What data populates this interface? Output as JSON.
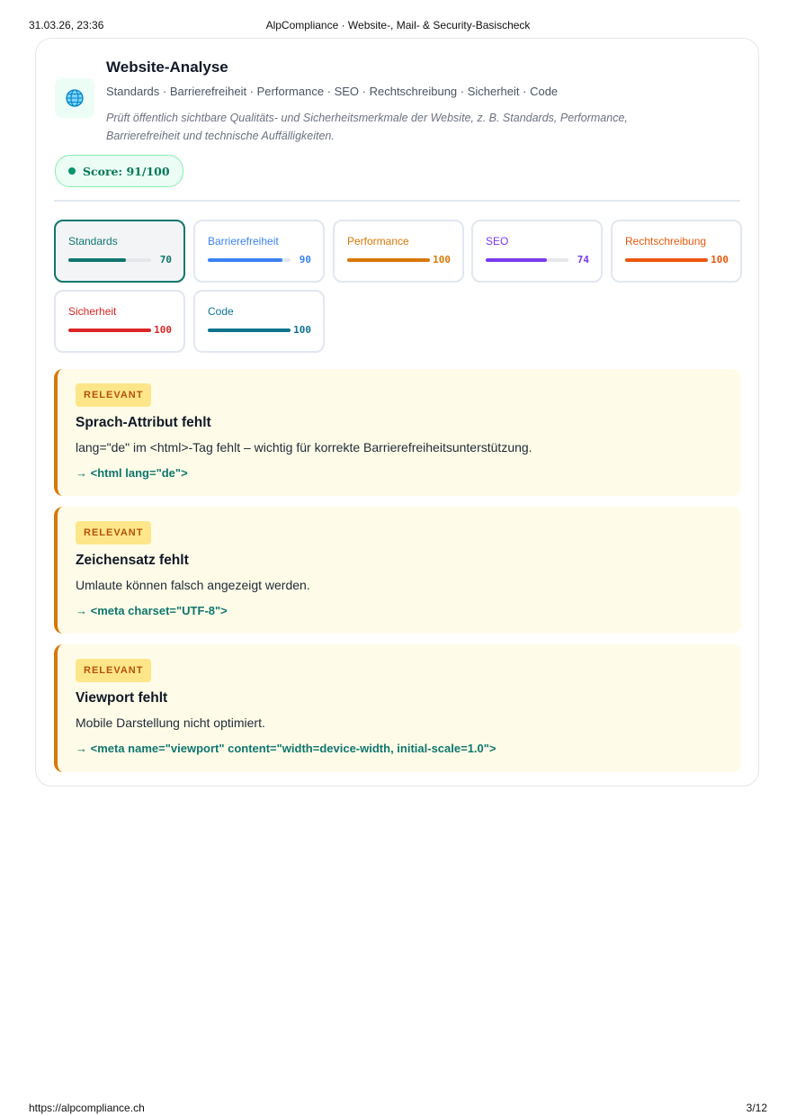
{
  "print_header": {
    "datetime": "31.03.26, 23:36",
    "title": "AlpCompliance · Website-, Mail- & Security-Basischeck"
  },
  "print_footer": {
    "url": "https://alpcompliance.ch",
    "page": "3/12"
  },
  "section": {
    "icon": "globe-icon",
    "title": "Website-Analyse",
    "subtitle": "Standards · Barrierefreiheit · Performance · SEO · Rechtschreibung · Sicherheit · Code",
    "description": "Prüft öffentlich sichtbare Qualitäts- und Sicherheitsmerkmale der Website, z. B. Standards, Performance, Barrierefreiheit und technische Auffälligkeiten.",
    "score_label": "Score: 91/100"
  },
  "categories": [
    {
      "label": "Standards",
      "value": "70",
      "score": 70,
      "color": "#0f766e",
      "active": true
    },
    {
      "label": "Barrierefreiheit",
      "value": "90",
      "score": 90,
      "color": "#3b82f6",
      "active": false
    },
    {
      "label": "Performance",
      "value": "100",
      "score": 100,
      "color": "#d97706",
      "active": false
    },
    {
      "label": "SEO",
      "value": "74",
      "score": 74,
      "color": "#7c3aed",
      "active": false
    },
    {
      "label": "Rechtschreibung",
      "value": "100",
      "score": 100,
      "color": "#ea580c",
      "active": false
    },
    {
      "label": "Sicherheit",
      "value": "100",
      "score": 100,
      "color": "#dc2626",
      "active": false
    },
    {
      "label": "Code",
      "value": "100",
      "score": 100,
      "color": "#0e7490",
      "active": false
    }
  ],
  "findings": [
    {
      "badge": "RELEVANT",
      "title": "Sprach-Attribut fehlt",
      "text": "lang=\"de\" im <html>-Tag fehlt – wichtig für korrekte Barrierefreiheitsunterstützung.",
      "fix": "→ <html lang=\"de\">"
    },
    {
      "badge": "RELEVANT",
      "title": "Zeichensatz fehlt",
      "text": "Umlaute können falsch angezeigt werden.",
      "fix": "→ <meta charset=\"UTF-8\">"
    },
    {
      "badge": "RELEVANT",
      "title": "Viewport fehlt",
      "text": "Mobile Darstellung nicht optimiert.",
      "fix": "→ <meta name=\"viewport\" content=\"width=device-width, initial-scale=1.0\">"
    }
  ]
}
